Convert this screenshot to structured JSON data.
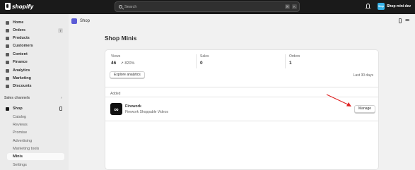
{
  "topbar": {
    "logo": "shopify",
    "search_placeholder": "Search",
    "shortcut": [
      "⌘",
      "K"
    ],
    "avatar_initials": "Shop",
    "store_name": "Shop mini dev"
  },
  "sidebar": {
    "items": [
      {
        "label": "Home",
        "icon": "home-icon"
      },
      {
        "label": "Orders",
        "icon": "orders-icon",
        "badge": "7"
      },
      {
        "label": "Products",
        "icon": "tag-icon"
      },
      {
        "label": "Customers",
        "icon": "person-icon"
      },
      {
        "label": "Content",
        "icon": "content-icon"
      },
      {
        "label": "Finance",
        "icon": "bank-icon"
      },
      {
        "label": "Analytics",
        "icon": "chart-icon"
      },
      {
        "label": "Marketing",
        "icon": "target-icon"
      },
      {
        "label": "Discounts",
        "icon": "discount-icon"
      }
    ],
    "section_label": "Sales channels",
    "channel": "Shop",
    "sub_items": [
      "Catalog",
      "Reviews",
      "Promise",
      "Advertising",
      "Marketing tools",
      "Minis",
      "Settings"
    ],
    "active_sub": "Minis"
  },
  "header": {
    "title": "Shop"
  },
  "page": {
    "heading": "Shop Minis",
    "stats": [
      {
        "label": "Views",
        "value": "46",
        "delta": "↗ 820%"
      },
      {
        "label": "Sales",
        "value": "0",
        "delta": ""
      },
      {
        "label": "Orders",
        "value": "1",
        "delta": ""
      }
    ],
    "explore_label": "Explore analytics",
    "period": "Last 30 days",
    "added_label": "Added",
    "minis": [
      {
        "name": "Firework",
        "description": "Firework Shoppable Videos",
        "action": "Manage"
      }
    ]
  },
  "colors": {
    "topbar": "#1a1a1a",
    "annotation_arrow": "#e02424",
    "shop_icon": "#5b5bd6"
  }
}
